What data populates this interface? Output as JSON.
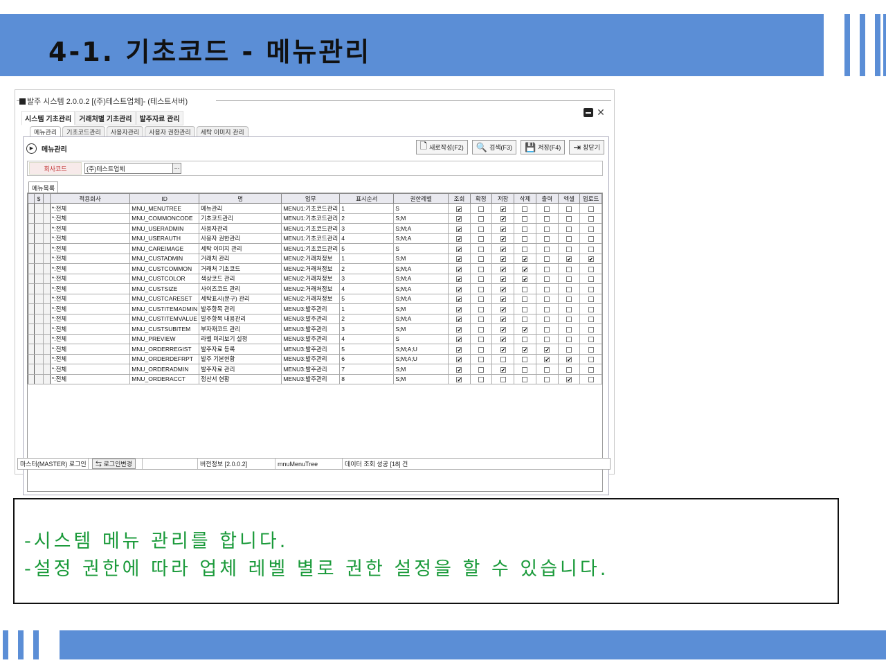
{
  "slide": {
    "title": "4-1. 기초코드 - 메뉴관리",
    "accent_color": "#5b8ed6",
    "description_lines": [
      "-시스템 메뉴 관리를 합니다.",
      "-설정 권한에 따라 업체 레벨 별로 권한 설정을 할 수 있습니다."
    ]
  },
  "window": {
    "title": "발주 시스템 2.0.0.2 [(주)테스트업체]- (테스트서버)",
    "top_tabs": [
      "시스템 기초관리",
      "거래처별 기초관리",
      "발주자료 관리"
    ],
    "sub_tabs": [
      "메뉴관리",
      "기초코드관리",
      "사용자관리",
      "사용자 권한관리",
      "세탁 이미지 관리"
    ],
    "panel_title": "메뉴관리",
    "toolbar": {
      "new_label": "새로작성(F2)",
      "search_label": "검색(F3)",
      "save_label": "저장(F4)",
      "close_label": "창닫기"
    },
    "company": {
      "label": "회사코드",
      "value": "(주)테스트업체",
      "button": "..."
    },
    "list_tab": "메뉴목록",
    "grid": {
      "columns": [
        "적용회사",
        "ID",
        "명",
        "업무",
        "표시순서",
        "권한레벨",
        "조회",
        "확정",
        "저장",
        "삭제",
        "출력",
        "엑셀",
        "업로드"
      ],
      "rows": [
        {
          "company": "*:전체",
          "id": "MNU_MENUTREE",
          "name": "메뉴관리",
          "task": "MENU1:기초코드관리",
          "order": "1",
          "level": "S",
          "checks": [
            1,
            0,
            1,
            0,
            0,
            0,
            0
          ]
        },
        {
          "company": "*:전체",
          "id": "MNU_COMMONCODE",
          "name": "기초코드관리",
          "task": "MENU1:기초코드관리",
          "order": "2",
          "level": "S;M",
          "checks": [
            1,
            0,
            1,
            0,
            0,
            0,
            0
          ]
        },
        {
          "company": "*:전체",
          "id": "MNU_USERADMIN",
          "name": "사용자관리",
          "task": "MENU1:기초코드관리",
          "order": "3",
          "level": "S;M;A",
          "checks": [
            1,
            0,
            1,
            0,
            0,
            0,
            0
          ]
        },
        {
          "company": "*:전체",
          "id": "MNU_USERAUTH",
          "name": "사용자 권한관리",
          "task": "MENU1:기초코드관리",
          "order": "4",
          "level": "S;M;A",
          "checks": [
            1,
            0,
            1,
            0,
            0,
            0,
            0
          ]
        },
        {
          "company": "*:전체",
          "id": "MNU_CAREIMAGE",
          "name": "세탁 이미지 관리",
          "task": "MENU1:기초코드관리",
          "order": "5",
          "level": "S",
          "checks": [
            1,
            0,
            1,
            0,
            0,
            0,
            0
          ]
        },
        {
          "company": "*:전체",
          "id": "MNU_CUSTADMIN",
          "name": "거래처 관리",
          "task": "MENU2:거래처정보",
          "order": "1",
          "level": "S;M",
          "checks": [
            1,
            0,
            1,
            1,
            0,
            1,
            1
          ]
        },
        {
          "company": "*:전체",
          "id": "MNU_CUSTCOMMON",
          "name": "거래처 기초코드",
          "task": "MENU2:거래처정보",
          "order": "2",
          "level": "S;M;A",
          "checks": [
            1,
            0,
            1,
            1,
            0,
            0,
            0
          ]
        },
        {
          "company": "*:전체",
          "id": "MNU_CUSTCOLOR",
          "name": "색상코드 관리",
          "task": "MENU2:거래처정보",
          "order": "3",
          "level": "S;M;A",
          "checks": [
            1,
            0,
            1,
            1,
            0,
            0,
            0
          ]
        },
        {
          "company": "*:전체",
          "id": "MNU_CUSTSIZE",
          "name": "사이즈코드 관리",
          "task": "MENU2:거래처정보",
          "order": "4",
          "level": "S;M;A",
          "checks": [
            1,
            0,
            1,
            0,
            0,
            0,
            0
          ]
        },
        {
          "company": "*:전체",
          "id": "MNU_CUSTCARESET",
          "name": "세탁표시(문구) 관리",
          "task": "MENU2:거래처정보",
          "order": "5",
          "level": "S;M;A",
          "checks": [
            1,
            0,
            1,
            0,
            0,
            0,
            0
          ]
        },
        {
          "company": "*:전체",
          "id": "MNU_CUSTITEMADMIN",
          "name": "발주항목 관리",
          "task": "MENU3:발주관리",
          "order": "1",
          "level": "S;M",
          "checks": [
            1,
            0,
            1,
            0,
            0,
            0,
            0
          ]
        },
        {
          "company": "*:전체",
          "id": "MNU_CUSTITEMVALUE",
          "name": "발주항목 내용관리",
          "task": "MENU3:발주관리",
          "order": "2",
          "level": "S;M;A",
          "checks": [
            1,
            0,
            1,
            0,
            0,
            0,
            0
          ]
        },
        {
          "company": "*:전체",
          "id": "MNU_CUSTSUBITEM",
          "name": "부자재코드 관리",
          "task": "MENU3:발주관리",
          "order": "3",
          "level": "S;M",
          "checks": [
            1,
            0,
            1,
            1,
            0,
            0,
            0
          ]
        },
        {
          "company": "*:전체",
          "id": "MNU_PREVIEW",
          "name": "라벨 미리보기 설정",
          "task": "MENU3:발주관리",
          "order": "4",
          "level": "S",
          "checks": [
            1,
            0,
            1,
            0,
            0,
            0,
            0
          ]
        },
        {
          "company": "*:전체",
          "id": "MNU_ORDERREGIST",
          "name": "발주자료 등록",
          "task": "MENU3:발주관리",
          "order": "5",
          "level": "S;M;A;U",
          "checks": [
            1,
            0,
            1,
            1,
            1,
            0,
            0
          ]
        },
        {
          "company": "*:전체",
          "id": "MNU_ORDERDEFRPT",
          "name": "발주 기본현황",
          "task": "MENU3:발주관리",
          "order": "6",
          "level": "S;M;A;U",
          "checks": [
            1,
            0,
            0,
            0,
            1,
            1,
            0
          ]
        },
        {
          "company": "*:전체",
          "id": "MNU_ORDERADMIN",
          "name": "발주자료 관리",
          "task": "MENU3:발주관리",
          "order": "7",
          "level": "S;M",
          "checks": [
            1,
            0,
            1,
            0,
            0,
            0,
            0
          ]
        },
        {
          "company": "*:전체",
          "id": "MNU_ORDERACCT",
          "name": "정산서 현황",
          "task": "MENU3:발주관리",
          "order": "8",
          "level": "S;M",
          "checks": [
            1,
            0,
            0,
            0,
            0,
            1,
            0
          ]
        }
      ]
    },
    "status": {
      "user": "마스터(MASTER) 로그인",
      "login_change": "로그인변경",
      "version": "버전정보 [2.0.0.2]",
      "form": "mnuMenuTree",
      "message": "데이터 조회 성공 [18] 건"
    }
  }
}
